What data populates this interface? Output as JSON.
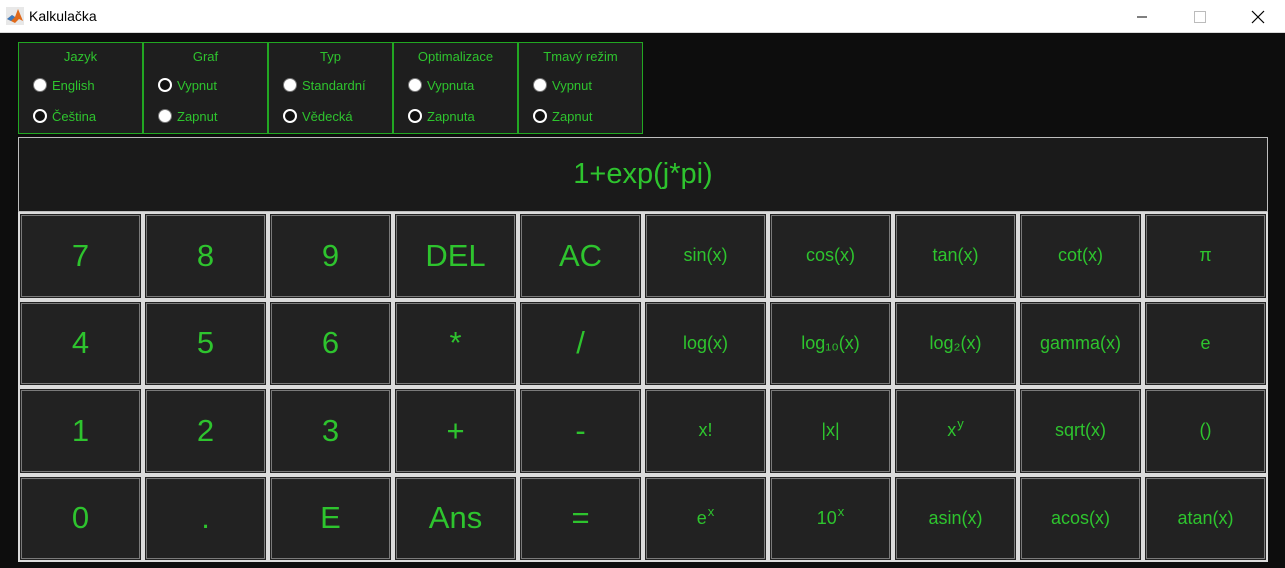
{
  "window": {
    "title": "Kalkulačka",
    "controls": [
      "minimize",
      "maximize",
      "close"
    ]
  },
  "settings": [
    {
      "title": "Jazyk",
      "options": [
        {
          "label": "English",
          "selected": true
        },
        {
          "label": "Čeština",
          "selected": false
        }
      ]
    },
    {
      "title": "Graf",
      "options": [
        {
          "label": "Vypnut",
          "selected": false
        },
        {
          "label": "Zapnut",
          "selected": true
        }
      ]
    },
    {
      "title": "Typ",
      "options": [
        {
          "label": "Standardní",
          "selected": true
        },
        {
          "label": "Vědecká",
          "selected": false
        }
      ]
    },
    {
      "title": "Optimalizace",
      "options": [
        {
          "label": "Vypnuta",
          "selected": true
        },
        {
          "label": "Zapnuta",
          "selected": false
        }
      ]
    },
    {
      "title": "Tmavý režim",
      "options": [
        {
          "label": "Vypnut",
          "selected": true
        },
        {
          "label": "Zapnut",
          "selected": false
        }
      ]
    }
  ],
  "display": {
    "expression": "1+exp(j*pi)"
  },
  "keys": {
    "seven": "7",
    "eight": "8",
    "nine": "9",
    "del": "DEL",
    "ac": "AC",
    "sin": "sin(x)",
    "cos": "cos(x)",
    "tan": "tan(x)",
    "cot": "cot(x)",
    "pi": "π",
    "four": "4",
    "five": "5",
    "six": "6",
    "multiply": "*",
    "divide": "/",
    "log": "log(x)",
    "log10": "log₁₀(x)",
    "log2": "log₂(x)",
    "gamma": "gamma(x)",
    "e": "e",
    "one": "1",
    "two": "2",
    "three": "3",
    "plus": "+",
    "minus": "-",
    "factorial": "x!",
    "abs": "|x|",
    "power_base": "x",
    "power_exp": "y",
    "sqrt": "sqrt(x)",
    "parens": "()",
    "zero": "0",
    "dot": ".",
    "exp_e": "E",
    "ans": "Ans",
    "equals": "=",
    "exp_base": "e",
    "exp_exp": "x",
    "ten_base": "10",
    "ten_exp": "x",
    "asin": "asin(x)",
    "acos": "acos(x)",
    "atan": "atan(x)"
  },
  "colors": {
    "accent": "#2ec42e",
    "background": "#0d0d0d",
    "key_background": "#222222",
    "key_border": "#dcdcdc"
  }
}
